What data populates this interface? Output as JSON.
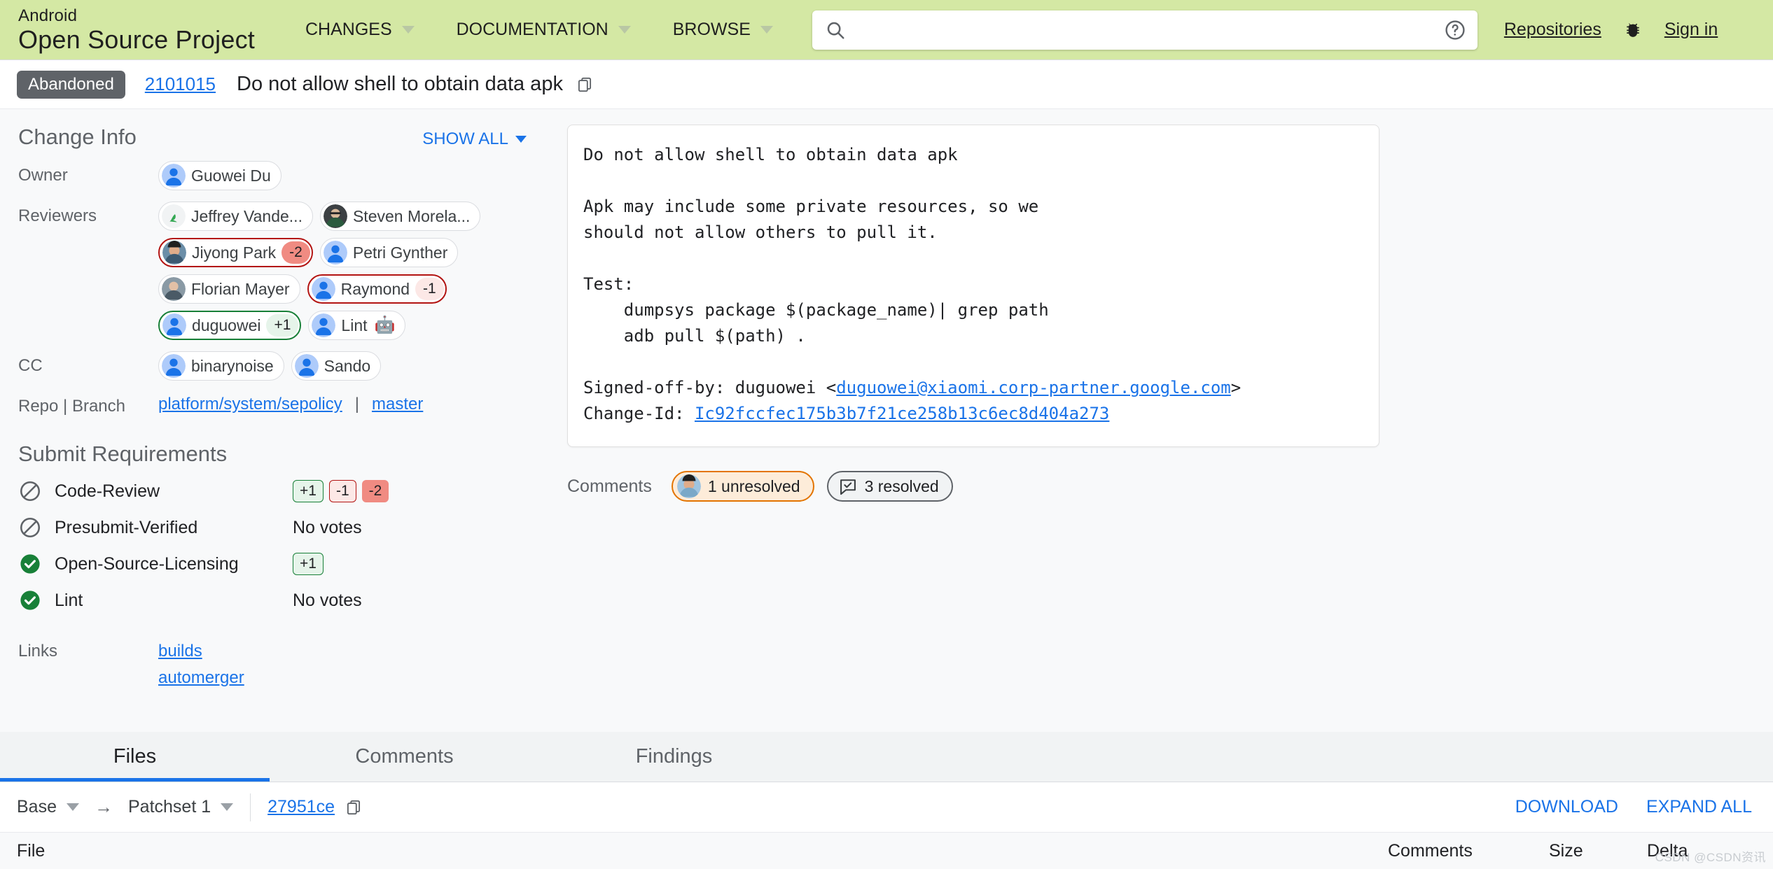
{
  "header": {
    "brand_top": "Android",
    "brand_bottom": "Open Source Project",
    "nav": [
      {
        "label": "CHANGES",
        "icon": "chevron-down-icon"
      },
      {
        "label": "DOCUMENTATION",
        "icon": "chevron-down-icon"
      },
      {
        "label": "BROWSE",
        "icon": "chevron-down-icon"
      }
    ],
    "search": {
      "value": "",
      "placeholder": "",
      "icon": "search-icon",
      "help_icon": "help-circle-icon"
    },
    "repositories_label": "Repositories",
    "bug_icon": "bug-icon",
    "signin_label": "Sign in"
  },
  "change": {
    "status": "Abandoned",
    "number": "2101015",
    "title": "Do not allow shell to obtain data apk",
    "copy_icon": "copy-icon"
  },
  "change_info": {
    "section_title": "Change Info",
    "show_all_label": "SHOW ALL",
    "owner_label": "Owner",
    "owner": [
      {
        "name": "Guowei Du",
        "avatar": "default",
        "vote": null
      }
    ],
    "reviewers_label": "Reviewers",
    "reviewers": [
      {
        "name": "Jeffrey Vande...",
        "avatar": "photo-green",
        "vote": null
      },
      {
        "name": "Steven Morela...",
        "avatar": "photo-dark",
        "vote": null
      },
      {
        "name": "Jiyong Park",
        "avatar": "photo-person",
        "vote": "-2"
      },
      {
        "name": "Petri Gynther",
        "avatar": "default",
        "vote": null
      },
      {
        "name": "Florian Mayer",
        "avatar": "photo-gray",
        "vote": null
      },
      {
        "name": "Raymond",
        "avatar": "default",
        "vote": "-1"
      },
      {
        "name": "duguowei",
        "avatar": "default",
        "vote": "+1"
      },
      {
        "name": "Lint",
        "avatar": "default",
        "vote": null,
        "robot": "🤖"
      }
    ],
    "cc_label": "CC",
    "cc": [
      {
        "name": "binarynoise",
        "avatar": "default",
        "vote": null
      },
      {
        "name": "Sando",
        "avatar": "default",
        "vote": null
      }
    ],
    "repo_branch_label": "Repo | Branch",
    "repo": "platform/system/sepolicy",
    "repo_branch_separator": "|",
    "branch": "master"
  },
  "submit_requirements": {
    "title": "Submit Requirements",
    "rows": [
      {
        "name": "Code-Review",
        "status": "blocked",
        "votes": [
          "+1",
          "-1",
          "-2"
        ],
        "no_votes_text": null
      },
      {
        "name": "Presubmit-Verified",
        "status": "blocked",
        "votes": [],
        "no_votes_text": "No votes"
      },
      {
        "name": "Open-Source-Licensing",
        "status": "satisfied",
        "votes": [
          "+1"
        ],
        "no_votes_text": null
      },
      {
        "name": "Lint",
        "status": "satisfied",
        "votes": [],
        "no_votes_text": "No votes"
      }
    ]
  },
  "links": {
    "label": "Links",
    "items": [
      "builds",
      "automerger"
    ]
  },
  "commit_message": {
    "line1": "Do not allow shell to obtain data apk",
    "line2": "",
    "line3": "Apk may include some private resources, so we",
    "line4": "should not allow others to pull it.",
    "line5": "",
    "line6": "Test:",
    "line7": "    dumpsys package $(package_name)| grep path",
    "line8": "    adb pull $(path) .",
    "line9": "",
    "signed_off_prefix": "Signed-off-by: duguowei <",
    "signed_off_email": "duguowei@xiaomi.corp-partner.google.com",
    "signed_off_suffix": ">",
    "change_id_prefix": "Change-Id: ",
    "change_id_value": "Ic92fccfec175b3b7f21ce258b13c6ec8d404a273"
  },
  "comments": {
    "label": "Comments",
    "unresolved": "1 unresolved",
    "resolved": "3 resolved",
    "unresolved_avatar": "photo-person",
    "resolved_icon": "comment-check-icon"
  },
  "tabs": [
    {
      "label": "Files",
      "active": true
    },
    {
      "label": "Comments",
      "active": false
    },
    {
      "label": "Findings",
      "active": false
    }
  ],
  "patchset_toolbar": {
    "base_label": "Base",
    "arrow": "→",
    "patchset_label": "Patchset 1",
    "sha": "27951ce",
    "copy_icon": "copy-icon",
    "download_label": "DOWNLOAD",
    "expand_all_label": "EXPAND ALL"
  },
  "file_table": {
    "columns": [
      "File",
      "Comments",
      "Size",
      "Delta"
    ],
    "rows": []
  },
  "watermark": "CSDN @CSDN资讯",
  "colors": {
    "header_green": "#d4e8a4",
    "link_blue": "#1a73e8",
    "status_gray": "#5f6368",
    "vote_neg2": "#f08b82",
    "vote_neg1": "#fce8e6",
    "vote_pos1": "#e6f4ea",
    "satisfied_green": "#188038",
    "unresolved_orange": "#e37400"
  }
}
